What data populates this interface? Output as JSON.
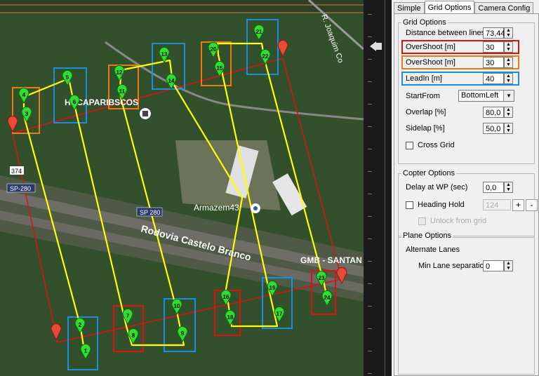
{
  "tabs": [
    "Simple",
    "Grid Options",
    "Camera Config"
  ],
  "active_tab": "Grid Options",
  "grid_options": {
    "legend": "Grid Options",
    "distance_label": "Distance between lines [m]",
    "distance_value": "73,44",
    "overshoot1_label": "OverShoot [m]",
    "overshoot1_value": "30",
    "overshoot2_label": "OverShoot [m]",
    "overshoot2_value": "30",
    "leadin_label": "LeadIn [m]",
    "leadin_value": "40",
    "startfrom_label": "StartFrom",
    "startfrom_value": "BottomLeft",
    "overlap_label": "Overlap [%]",
    "overlap_value": "80,0",
    "sidelap_label": "Sidelap [%]",
    "sidelap_value": "50,0",
    "crossgrid_label": "Cross Grid"
  },
  "copter_options": {
    "legend": "Copter Options",
    "delay_label": "Delay at WP (sec)",
    "delay_value": "0,0",
    "heading_hold_label": "Heading Hold",
    "heading_value": "124",
    "plus_label": "+",
    "minus_label": "-",
    "unlock_label": "Unlock from grid"
  },
  "plane_options": {
    "legend": "Plane Options",
    "alternate_label": "Alternate Lanes",
    "min_lane_label": "Min Lane separation",
    "min_lane_value": "0"
  },
  "highlight_colors": {
    "red": "#e01010",
    "orange": "#f07a10",
    "blue": "#1a8ee0",
    "yellow": "#ffff00"
  },
  "map": {
    "labels": {
      "road_top": "R. Joaquim Co",
      "hacaparibscos": "HACAPARIBSCOS",
      "armazem": "Armazem43",
      "rodovia": "Rodovia Castelo Branco",
      "sp280_a": "SP-280",
      "sp280_b": "SP 280",
      "km": "374",
      "gmb": "GMB - SANTAN"
    },
    "waypoints": [
      "1",
      "2",
      "3",
      "4",
      "5",
      "6",
      "7",
      "8",
      "9",
      "10",
      "11",
      "12",
      "13",
      "14",
      "15",
      "16",
      "17",
      "18",
      "19",
      "20",
      "21",
      "22",
      "23",
      "24"
    ]
  }
}
